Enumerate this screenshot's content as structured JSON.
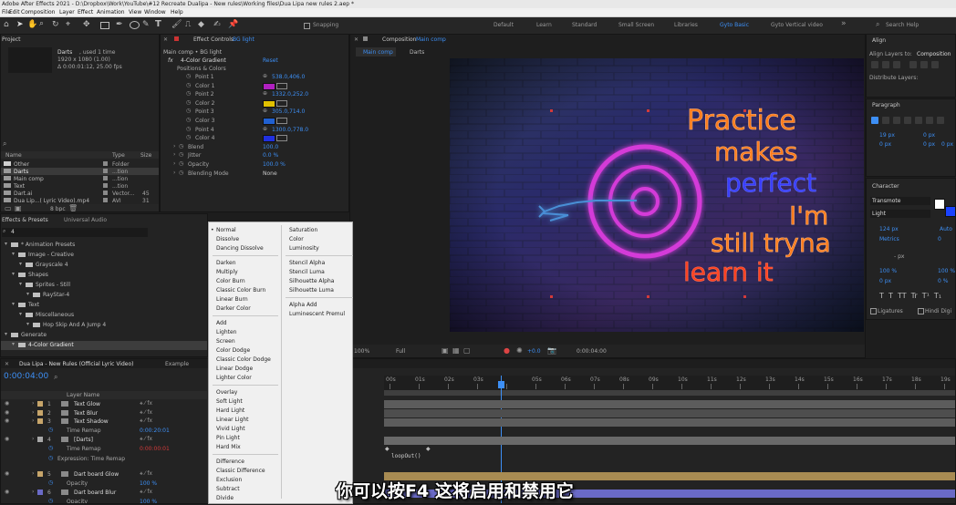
{
  "app_title": "Adobe After Effects 2021 - D:\\Dropbox\\Work\\YouTube\\#12 Recreate Dualipa - New rules\\Working files\\Dua Lipa new rules 2.aep *",
  "menu": [
    "File",
    "Edit",
    "Composition",
    "Layer",
    "Effect",
    "Animation",
    "View",
    "Window",
    "Help"
  ],
  "toolbar": {
    "snapping_label": "Snapping"
  },
  "workspaces": [
    "Default",
    "Learn",
    "Standard",
    "Small Screen",
    "Libraries",
    "Gyto Basic",
    "Gyto Vertical video"
  ],
  "search_help": "Search Help",
  "project": {
    "title": "Project",
    "item_name": "Darts",
    "item_used": ", used 1 time",
    "item_size": "1920 x 1080 (1.00)",
    "item_dur": "Δ 0:00:01:12, 25.00 fps",
    "columns": {
      "name": "Name",
      "type": "Type",
      "size": "Size"
    },
    "items": [
      {
        "name": "Other",
        "type": "Folder",
        "size": ""
      },
      {
        "name": "Darts",
        "type": "...tion",
        "size": ""
      },
      {
        "name": "Main comp",
        "type": "...tion",
        "size": ""
      },
      {
        "name": "Text",
        "type": "...tion",
        "size": ""
      },
      {
        "name": "Dart.ai",
        "type": "Vector...",
        "size": "45"
      },
      {
        "name": "Dua Lip...( Lyric Video).mp4",
        "type": "AVI",
        "size": "31"
      },
      {
        "name": "pexels-...houye-1064020.jpg",
        "type": "Importe...",
        "size": "3.6"
      }
    ],
    "bpc": "8 bpc"
  },
  "effect_controls": {
    "title": "Effect Controls",
    "target": "BG light",
    "breadcrumb": "Main comp • BG light",
    "effect_name": "4-Color Gradient",
    "reset": "Reset",
    "group": "Positions & Colors",
    "props": [
      {
        "name": "Point 1",
        "value": "538.0,406.0",
        "color": ""
      },
      {
        "name": "Color 1",
        "value": "",
        "color": "#b020c0"
      },
      {
        "name": "Point 2",
        "value": "1332.0,252.0",
        "color": ""
      },
      {
        "name": "Color 2",
        "value": "",
        "color": "#e0c000"
      },
      {
        "name": "Point 3",
        "value": "305.0,714.0",
        "color": ""
      },
      {
        "name": "Color 3",
        "value": "",
        "color": "#2060d0"
      },
      {
        "name": "Point 4",
        "value": "1300.0,778.0",
        "color": ""
      },
      {
        "name": "Color 4",
        "value": "",
        "color": "#2030e0"
      }
    ],
    "extra": [
      {
        "name": "Blend",
        "value": "100.0"
      },
      {
        "name": "Jitter",
        "value": "0.0 %"
      },
      {
        "name": "Opacity",
        "value": "100.0 %"
      },
      {
        "name": "Blending Mode",
        "value": "None"
      }
    ]
  },
  "effects_presets": {
    "title": "Effects & Presets",
    "tab2": "Universal Audio",
    "search": "4",
    "tree": [
      {
        "label": "* Animation Presets",
        "depth": 0
      },
      {
        "label": "Image - Creative",
        "depth": 1
      },
      {
        "label": "Grayscale 4",
        "depth": 2
      },
      {
        "label": "Shapes",
        "depth": 1
      },
      {
        "label": "Sprites - Still",
        "depth": 2
      },
      {
        "label": "RayStar-4",
        "depth": 3
      },
      {
        "label": "Text",
        "depth": 1
      },
      {
        "label": "Miscellaneous",
        "depth": 2
      },
      {
        "label": "Hop Skip And A Jump 4",
        "depth": 3
      },
      {
        "label": "Generate",
        "depth": 0
      },
      {
        "label": "4-Color Gradient",
        "depth": 1
      }
    ]
  },
  "composition": {
    "title": "Composition",
    "name": "Main comp",
    "tabs": [
      "Main comp",
      "Darts"
    ],
    "neon_lines": [
      "Practice",
      "makes",
      "perfect",
      "I'm",
      "still tryna",
      "learn it"
    ],
    "zoom": "100%",
    "quality": "Full",
    "timecode": "0:00:04:00",
    "exposure": "+0.0"
  },
  "align": {
    "title": "Align",
    "align_to_label": "Align Layers to:",
    "align_to": "Composition",
    "distribute": "Distribute Layers:"
  },
  "paragraph": {
    "title": "Paragraph",
    "indent1": "19 px",
    "indent2": "0 px",
    "indent3": "0 px",
    "space1": "0 px",
    "space2": "0 px"
  },
  "character": {
    "title": "Character",
    "font": "Transmote",
    "style": "Light",
    "size": "124 px",
    "leading": "Auto",
    "kerning": "Metrics",
    "tracking": "0",
    "stroke": "- px",
    "vscale": "100 %",
    "hscale": "100 %",
    "baseline": "0 px",
    "tsume": "0 %",
    "ligatures": "Ligatures",
    "hindi": "Hindi Digi"
  },
  "timeline": {
    "tabs": [
      "Dua Lipa - New Rules (Official Lyric Video)",
      "Example"
    ],
    "current_time": "0:00:04:00",
    "fps_line": "00100 (25.00 fps)",
    "header": "Layer Name",
    "layers": [
      {
        "num": "1",
        "name": "Text Glow",
        "color": "#c7a56a"
      },
      {
        "num": "2",
        "name": "Text Blur",
        "color": "#c7a56a"
      },
      {
        "num": "3",
        "name": "Text Shadow",
        "color": "#c7a56a"
      },
      {
        "num": "",
        "name": "Time Remap",
        "color": "",
        "value": "0:00:20:01"
      },
      {
        "num": "4",
        "name": "[Darts]",
        "color": "#a8a8a8"
      },
      {
        "num": "",
        "name": "Time Remap",
        "color": "",
        "value": "0:00:00:01"
      },
      {
        "num": "",
        "name": "Expression: Time Remap",
        "color": "",
        "value": ""
      },
      {
        "num": "5",
        "name": "Dart board Glow",
        "color": "#c7a56a"
      },
      {
        "num": "",
        "name": "Opacity",
        "color": "",
        "value": "100 %"
      },
      {
        "num": "6",
        "name": "Dart board Blur",
        "color": "#6a6ac7"
      },
      {
        "num": "",
        "name": "Opacity",
        "color": "",
        "value": "100 %"
      }
    ],
    "ruler": [
      "00s",
      "01s",
      "02s",
      "03s",
      "",
      "05s",
      "06s",
      "07s",
      "08s",
      "09s",
      "10s",
      "11s",
      "12s",
      "13s",
      "14s",
      "15s",
      "16s",
      "17s",
      "18s",
      "19s"
    ],
    "expression_text": "loopOut()"
  },
  "blend_menu": {
    "col1": [
      [
        "Normal",
        "Dissolve",
        "Dancing Dissolve"
      ],
      [
        "Darken",
        "Multiply",
        "Color Burn",
        "Classic Color Burn",
        "Linear Burn",
        "Darker Color"
      ],
      [
        "Add",
        "Lighten",
        "Screen",
        "Color Dodge",
        "Classic Color Dodge",
        "Linear Dodge",
        "Lighter Color"
      ],
      [
        "Overlay",
        "Soft Light",
        "Hard Light",
        "Linear Light",
        "Vivid Light",
        "Pin Light",
        "Hard Mix"
      ],
      [
        "Difference",
        "Classic Difference",
        "Exclusion",
        "Subtract",
        "Divide"
      ]
    ],
    "col2": [
      [
        "Saturation",
        "Color",
        "Luminosity"
      ],
      [
        "Stencil Alpha",
        "Stencil Luma",
        "Silhouette Alpha",
        "Silhouette Luma"
      ],
      [
        "Alpha Add",
        "Luminescent Premul"
      ]
    ]
  },
  "subtitle": "你可以按F4 这将启用和禁用它"
}
